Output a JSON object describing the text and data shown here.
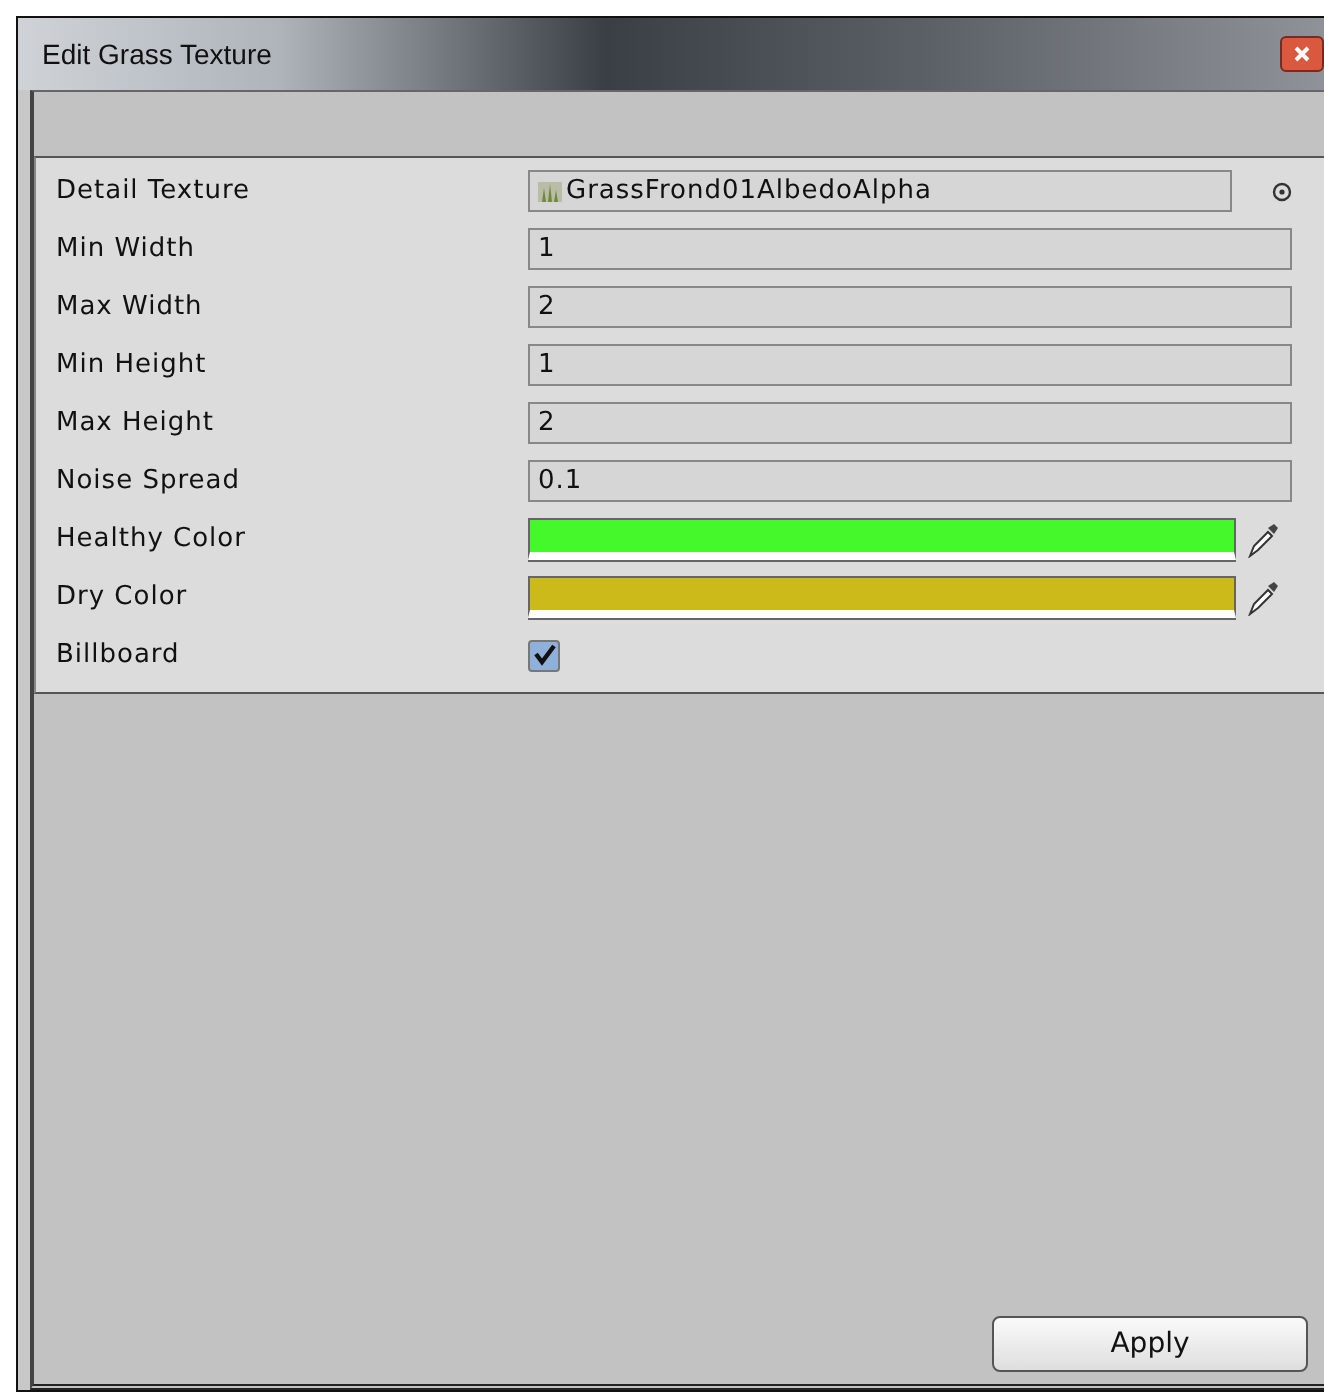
{
  "window": {
    "title": "Edit Grass Texture"
  },
  "fields": [
    {
      "kind": "object",
      "label": "Detail Texture",
      "value": "GrassFrond01AlbedoAlpha"
    },
    {
      "kind": "text",
      "label": "Min Width",
      "value": "1"
    },
    {
      "kind": "text",
      "label": "Max Width",
      "value": "2"
    },
    {
      "kind": "text",
      "label": "Min Height",
      "value": "1"
    },
    {
      "kind": "text",
      "label": "Max Height",
      "value": "2"
    },
    {
      "kind": "text",
      "label": "Noise Spread",
      "value": "0.1"
    },
    {
      "kind": "color",
      "label": "Healthy Color",
      "color": "#44f82c"
    },
    {
      "kind": "color",
      "label": "Dry Color",
      "color": "#ccb91a"
    },
    {
      "kind": "checkbox",
      "label": "Billboard",
      "checked": true
    }
  ],
  "buttons": [
    "Apply"
  ]
}
